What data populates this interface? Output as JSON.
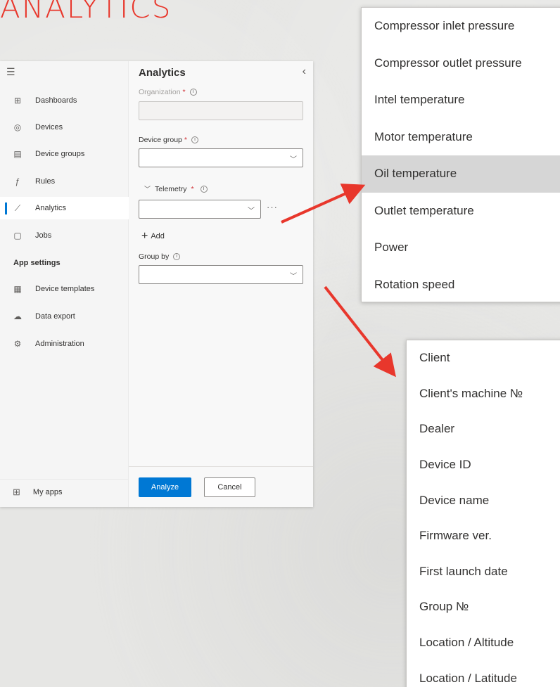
{
  "heading": "ANALYTICS",
  "sidebar": {
    "items": [
      {
        "label": "Dashboards",
        "icon": "dashboard-icon"
      },
      {
        "label": "Devices",
        "icon": "devices-icon"
      },
      {
        "label": "Device groups",
        "icon": "device-groups-icon"
      },
      {
        "label": "Rules",
        "icon": "rules-icon"
      },
      {
        "label": "Analytics",
        "icon": "analytics-icon"
      },
      {
        "label": "Jobs",
        "icon": "jobs-icon"
      }
    ],
    "section_label": "App settings",
    "settings_items": [
      {
        "label": "Device templates",
        "icon": "device-templates-icon"
      },
      {
        "label": "Data export",
        "icon": "data-export-icon"
      },
      {
        "label": "Administration",
        "icon": "administration-icon"
      }
    ],
    "my_apps": "My apps"
  },
  "panel": {
    "title": "Analytics",
    "organization_label": "Organization",
    "device_group_label": "Device group",
    "telemetry_label": "Telemetry",
    "add_label": "Add",
    "group_by_label": "Group by",
    "analyze_label": "Analyze",
    "cancel_label": "Cancel"
  },
  "telemetry_options": [
    "Compressor inlet pressure",
    "Compressor outlet pressure",
    "Intel temperature",
    "Motor temperature",
    "Oil temperature",
    "Outlet temperature",
    "Power",
    "Rotation speed"
  ],
  "telemetry_highlighted": "Oil temperature",
  "group_by_options": [
    "Client",
    "Client's machine №",
    "Dealer",
    "Device ID",
    "Device name",
    "Firmware ver.",
    "First launch date",
    "Group №",
    "Location / Altitude",
    "Location / Latitude"
  ],
  "colors": {
    "accent": "#0078d4",
    "heading": "#e8372c",
    "arrow": "#e8372c"
  }
}
